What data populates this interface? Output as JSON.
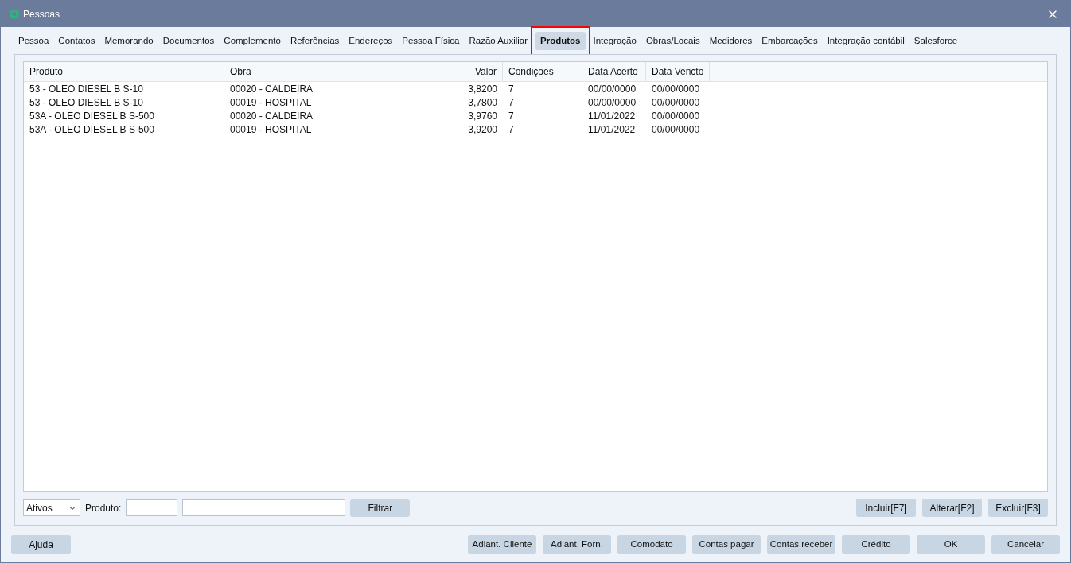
{
  "window": {
    "title": "Pessoas"
  },
  "tabs": [
    {
      "label": "Pessoa",
      "selected": false,
      "outlined": false
    },
    {
      "label": "Contatos",
      "selected": false,
      "outlined": false
    },
    {
      "label": "Memorando",
      "selected": false,
      "outlined": false
    },
    {
      "label": "Documentos",
      "selected": false,
      "outlined": false
    },
    {
      "label": "Complemento",
      "selected": false,
      "outlined": false
    },
    {
      "label": "Referências",
      "selected": false,
      "outlined": false
    },
    {
      "label": "Endereços",
      "selected": false,
      "outlined": false
    },
    {
      "label": "Pessoa Física",
      "selected": false,
      "outlined": false
    },
    {
      "label": "Razão Auxiliar",
      "selected": false,
      "outlined": false
    },
    {
      "label": "Produtos",
      "selected": true,
      "outlined": true
    },
    {
      "label": "Integração",
      "selected": false,
      "outlined": false
    },
    {
      "label": "Obras/Locais",
      "selected": false,
      "outlined": false
    },
    {
      "label": "Medidores",
      "selected": false,
      "outlined": false
    },
    {
      "label": "Embarcações",
      "selected": false,
      "outlined": false
    },
    {
      "label": "Integração contábil",
      "selected": false,
      "outlined": false
    },
    {
      "label": "Salesforce",
      "selected": false,
      "outlined": false
    }
  ],
  "table": {
    "columns": [
      "Produto",
      "Obra",
      "Valor",
      "Condições",
      "Data Acerto",
      "Data Vencto"
    ],
    "rows": [
      [
        "53 - OLEO DIESEL B S-10",
        "00020 - CALDEIRA",
        "3,8200",
        "7",
        "00/00/0000",
        "00/00/0000"
      ],
      [
        "53 - OLEO DIESEL B S-10",
        "00019 - HOSPITAL",
        "3,7800",
        "7",
        "00/00/0000",
        "00/00/0000"
      ],
      [
        "53A - OLEO DIESEL B S-500",
        "00020 - CALDEIRA",
        "3,9760",
        "7",
        "11/01/2022",
        "00/00/0000"
      ],
      [
        "53A - OLEO DIESEL B S-500",
        "00019 - HOSPITAL",
        "3,9200",
        "7",
        "11/01/2022",
        "00/00/0000"
      ]
    ]
  },
  "filter": {
    "status": "Ativos",
    "product_label": "Produto:",
    "filter_button": "Filtrar"
  },
  "actions": [
    "Incluir[F7]",
    "Alterar[F2]",
    "Excluir[F3]"
  ],
  "footer": {
    "help": "Ajuda",
    "buttons": [
      "Adiant. Cliente",
      "Adiant. Forn.",
      "Comodato",
      "Contas pagar",
      "Contas receber",
      "Crédito",
      "OK",
      "Cancelar"
    ]
  }
}
